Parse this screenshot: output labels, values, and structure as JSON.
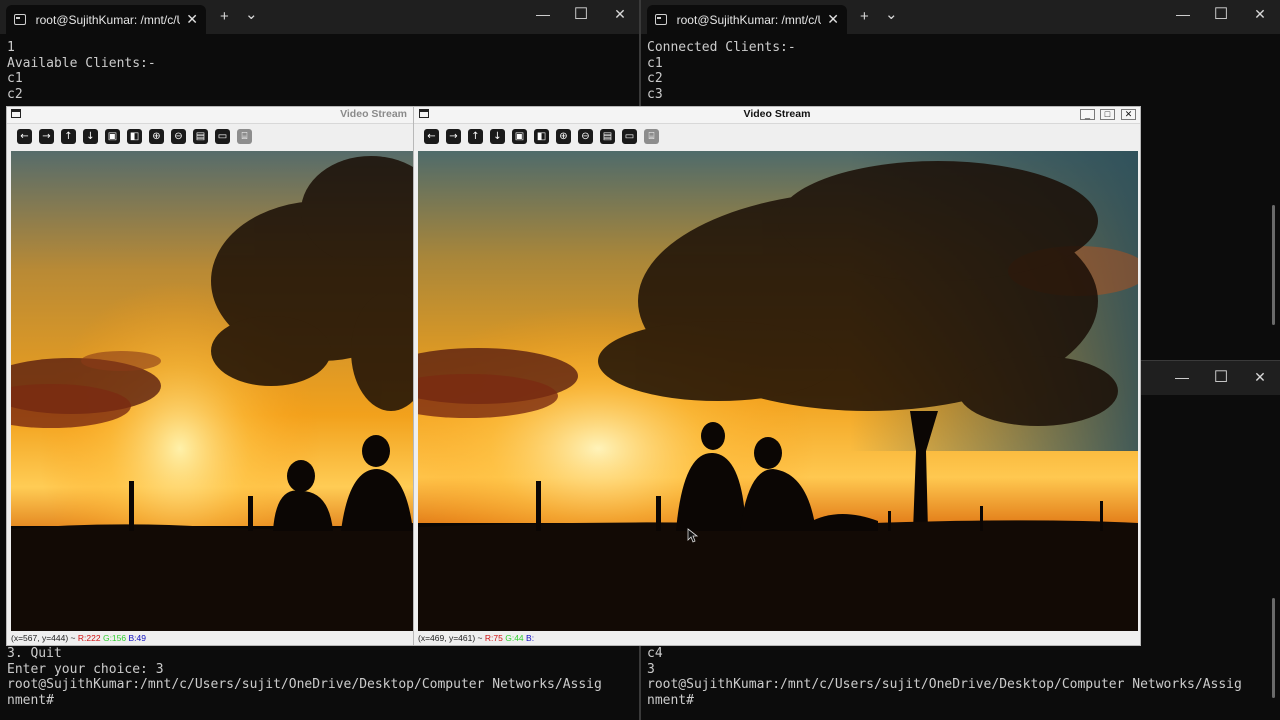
{
  "left_terminal": {
    "tab_title": "root@SujithKumar: /mnt/c/Us",
    "tab_close": "✕",
    "new_tab": "+",
    "dropdown": "⌄",
    "minimize": "—",
    "maximize": "☐",
    "close": "✕",
    "top_lines": [
      "1",
      "Available Clients:-",
      "c1",
      "c2"
    ],
    "bottom_lines": [
      "3. Quit",
      "Enter your choice: 3",
      "root@SujithKumar:/mnt/c/Users/sujit/OneDrive/Desktop/Computer Networks/Assig",
      "nment#"
    ]
  },
  "right_terminal": {
    "tab_title": "root@SujithKumar: /mnt/c/Us",
    "tab_close": "✕",
    "new_tab": "+",
    "dropdown": "⌄",
    "minimize": "—",
    "maximize": "☐",
    "close": "✕",
    "top_lines": [
      "Connected Clients:-",
      "c1",
      "c2",
      "c3"
    ],
    "bottom_lines": [
      "c4",
      "3",
      "root@SujithKumar:/mnt/c/Users/sujit/OneDrive/Desktop/Computer Networks/Assig",
      "nment#"
    ]
  },
  "third_terminal": {
    "minimize": "—",
    "maximize": "☐",
    "close": "✕"
  },
  "video_left": {
    "title": "Video Stream",
    "status_coords": "(x=567, y=444) ~",
    "status_r": "R:222",
    "status_g": "G:156",
    "status_b": "B:49",
    "toolbar_icons": [
      "arrow-left-icon",
      "arrow-right-icon",
      "arrow-up-icon",
      "arrow-down-icon",
      "zoom-fit-icon",
      "zoom-original-icon",
      "zoom-in-icon",
      "zoom-out-icon",
      "save-icon",
      "properties-icon",
      "settings-icon"
    ]
  },
  "video_right": {
    "title": "Video Stream",
    "status_coords": "(x=469, y=461) ~",
    "status_r": "R:75",
    "status_g": "G:44",
    "status_b": "B:",
    "win_min": "_",
    "win_max": "□",
    "win_close": "✕",
    "toolbar_icons": [
      "arrow-left-icon",
      "arrow-right-icon",
      "arrow-up-icon",
      "arrow-down-icon",
      "zoom-fit-icon",
      "zoom-original-icon",
      "zoom-in-icon",
      "zoom-out-icon",
      "save-icon",
      "properties-icon",
      "settings-icon"
    ]
  },
  "colors": {
    "terminal_bg": "#0c0c0c",
    "tabbar_bg": "#1f1f1f",
    "status_red": "#d01010",
    "status_green": "#30d030",
    "status_blue": "#1010c0",
    "sky_orange": "#f5a020",
    "sky_teal": "#5f7d78"
  }
}
